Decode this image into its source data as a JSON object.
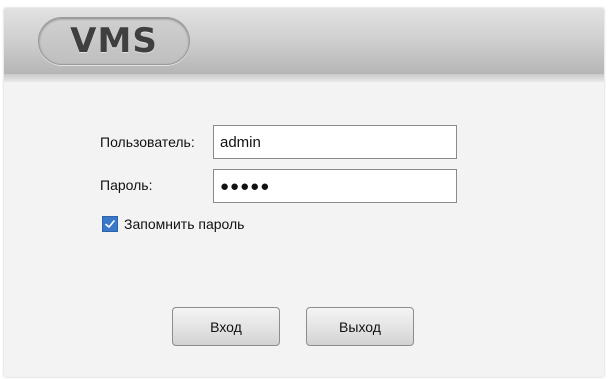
{
  "app": {
    "logo_text": "VMS"
  },
  "login": {
    "username_label": "Пользователь:",
    "username_value": "admin",
    "password_label": "Пароль:",
    "password_masked": "●●●●●",
    "remember_label": "Запомнить пароль",
    "remember_checked": true
  },
  "buttons": {
    "login_label": "Вход",
    "exit_label": "Выход"
  },
  "colors": {
    "checkbox_accent": "#3a78c9"
  },
  "icons": {
    "checkbox": "checkmark-icon"
  }
}
